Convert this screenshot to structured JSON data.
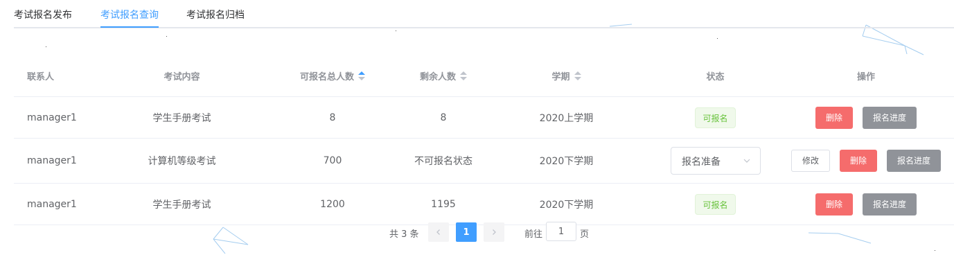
{
  "tabs": [
    {
      "label": "考试报名发布",
      "active": false
    },
    {
      "label": "考试报名查询",
      "active": true
    },
    {
      "label": "考试报名归档",
      "active": false
    }
  ],
  "columns": {
    "contact": "联系人",
    "content": "考试内容",
    "total": "可报名总人数",
    "remaining": "剩余人数",
    "term": "学期",
    "status": "状态",
    "actions": "操作"
  },
  "rows": [
    {
      "contact": "manager1",
      "content": "学生手册考试",
      "total": "8",
      "remaining": "8",
      "term": "2020上学期",
      "status": "可报名"
    },
    {
      "contact": "manager1",
      "content": "计算机等级考试",
      "total": "700",
      "remaining": "不可报名状态",
      "term": "2020下学期",
      "status_select": "报名准备"
    },
    {
      "contact": "manager1",
      "content": "学生手册考试",
      "total": "1200",
      "remaining": "1195",
      "term": "2020下学期",
      "status": "可报名"
    }
  ],
  "buttons": {
    "edit": "修改",
    "delete": "删除",
    "progress": "报名进度"
  },
  "pagination": {
    "total_text": "共 3 条",
    "current_page": "1",
    "goto_label": "前往",
    "goto_value": "1",
    "page_suffix": "页"
  },
  "icons": {
    "sort": "sort-caret-icon",
    "select_arrow": "chevron-down-icon",
    "prev": "chevron-left-icon",
    "next": "chevron-right-icon"
  },
  "colors": {
    "accent": "#409eff",
    "danger": "#f56c6c",
    "info": "#909399",
    "success": "#67c23a"
  }
}
